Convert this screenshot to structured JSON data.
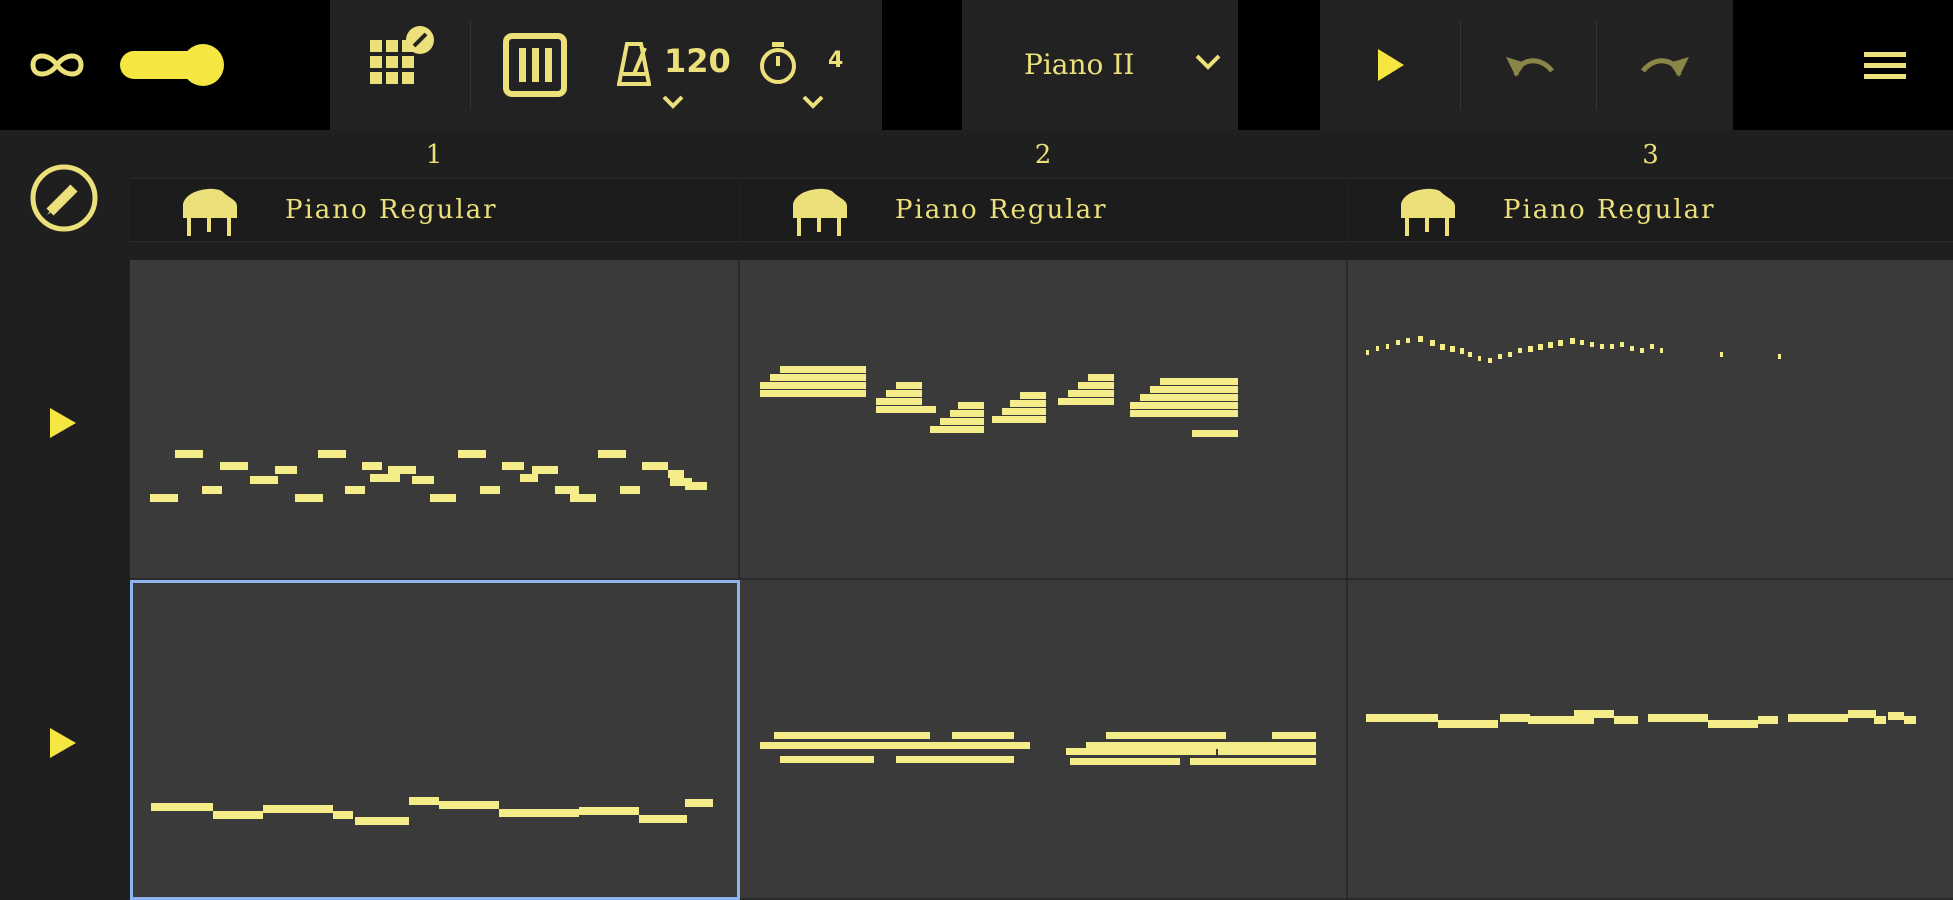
{
  "toolbar": {
    "tempo": "120",
    "bars": "4",
    "instrument_label": "Piano II"
  },
  "colors": {
    "accent": "#ece07a",
    "background": "#000000",
    "grid": "#3a3a3a",
    "selection": "#8eb4f0"
  },
  "columns": [
    {
      "number": "1",
      "instrument": "Piano Regular"
    },
    {
      "number": "2",
      "instrument": "Piano Regular"
    },
    {
      "number": "3",
      "instrument": "Piano Regular"
    }
  ],
  "icons": [
    "loop-icon",
    "toggle-switch",
    "pad-grid-edit-icon",
    "piano-roll-icon",
    "metronome-icon",
    "timer-icon",
    "chevron-down-icon",
    "play-icon",
    "undo-icon",
    "redo-icon",
    "menu-icon",
    "pencil-icon",
    "grand-piano-icon"
  ]
}
